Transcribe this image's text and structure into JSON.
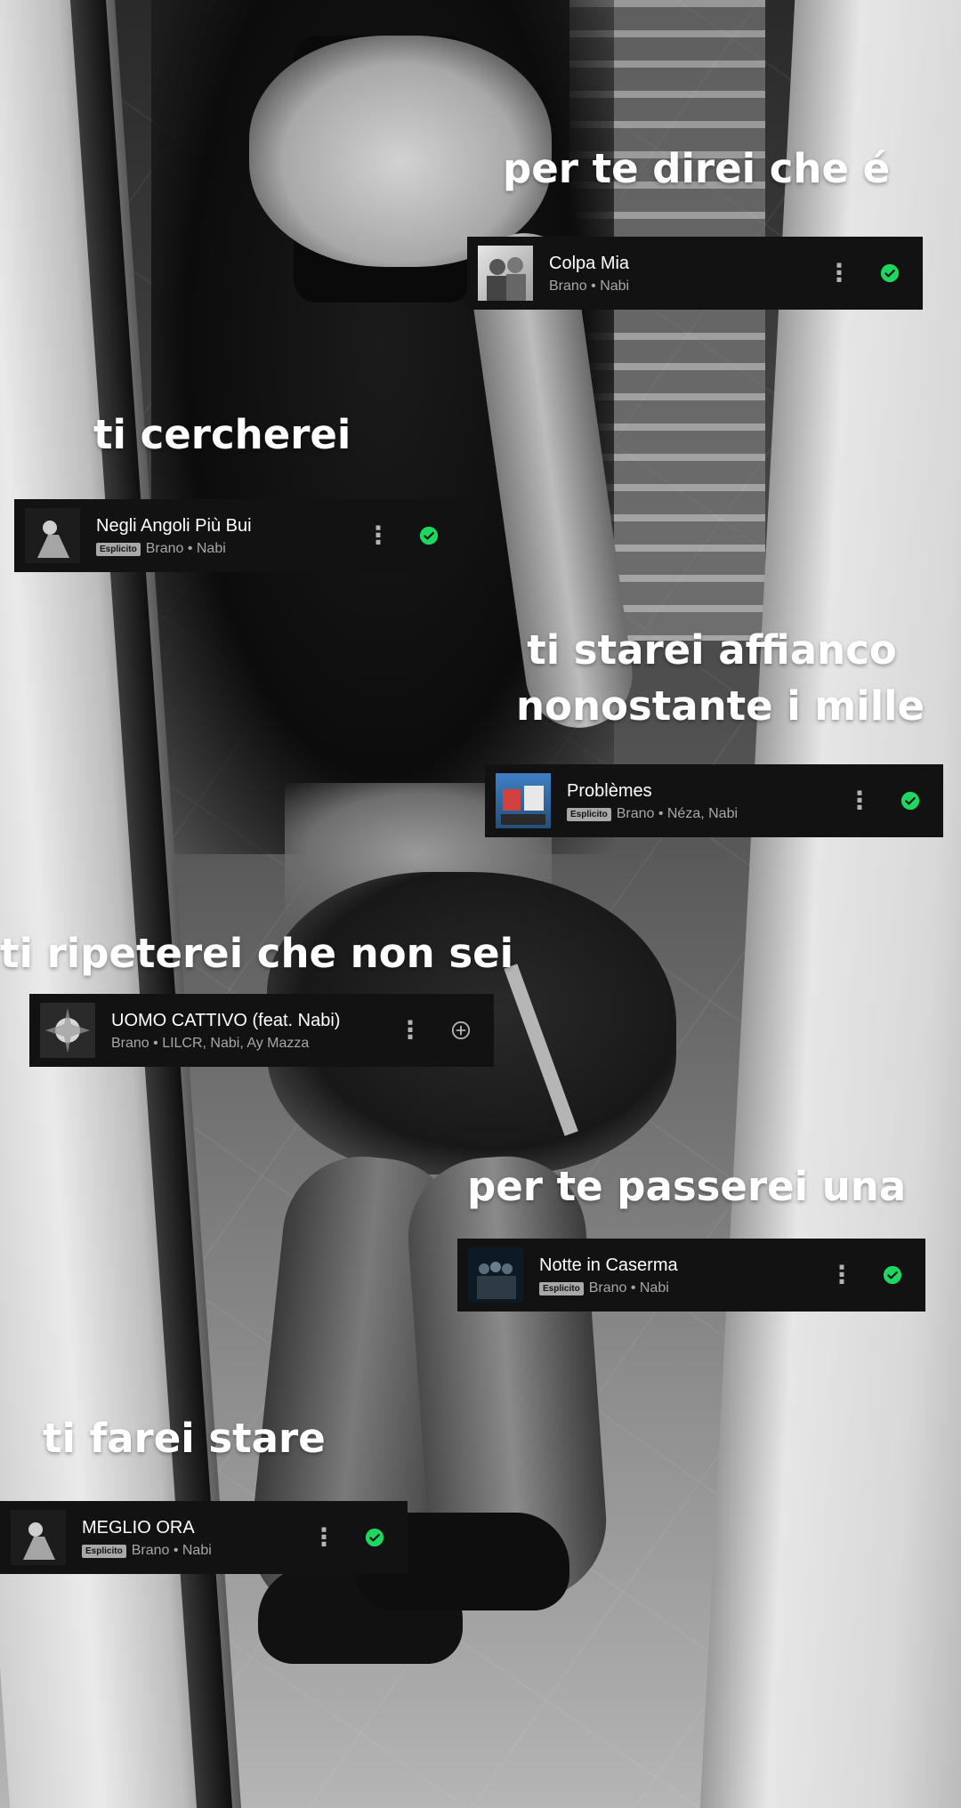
{
  "captions": {
    "c1": "per te direi che é",
    "c2": "ti cercherei",
    "c3_line1": "ti starei affianco",
    "c3_line2": "nonostante i mille",
    "c4": "ti ripeterei che non sei",
    "c5": "per te passerei una",
    "c6": "ti farei stare"
  },
  "tracks": [
    {
      "title": "Colpa Mia",
      "explicit": false,
      "badge": "",
      "subtitle": "Brano • Nabi",
      "menu_icon": "more-vert-icon",
      "status_icon": "check-circle-icon"
    },
    {
      "title": "Negli Angoli Più Bui",
      "explicit": true,
      "badge": "Esplicito",
      "subtitle": "Brano • Nabi",
      "menu_icon": "more-vert-icon",
      "status_icon": "check-circle-icon"
    },
    {
      "title": "Problèmes",
      "explicit": true,
      "badge": "Esplicito",
      "subtitle": "Brano • Néza, Nabi",
      "menu_icon": "more-vert-icon",
      "status_icon": "check-circle-icon"
    },
    {
      "title": "UOMO CATTIVO (feat. Nabi)",
      "explicit": false,
      "badge": "",
      "subtitle": "Brano • LILCR, Nabi, Ay Mazza",
      "menu_icon": "more-vert-icon",
      "status_icon": "add-circle-icon"
    },
    {
      "title": "Notte in Caserma",
      "explicit": true,
      "badge": "Esplicito",
      "subtitle": "Brano • Nabi",
      "menu_icon": "more-vert-icon",
      "status_icon": "check-circle-icon"
    },
    {
      "title": "MEGLIO ORA",
      "explicit": true,
      "badge": "Esplicito",
      "subtitle": "Brano • Nabi",
      "menu_icon": "more-vert-icon",
      "status_icon": "check-circle-icon"
    }
  ],
  "colors": {
    "accent_green": "#1ed760",
    "card_background": "#121212",
    "caption_text": "#ffffff"
  }
}
